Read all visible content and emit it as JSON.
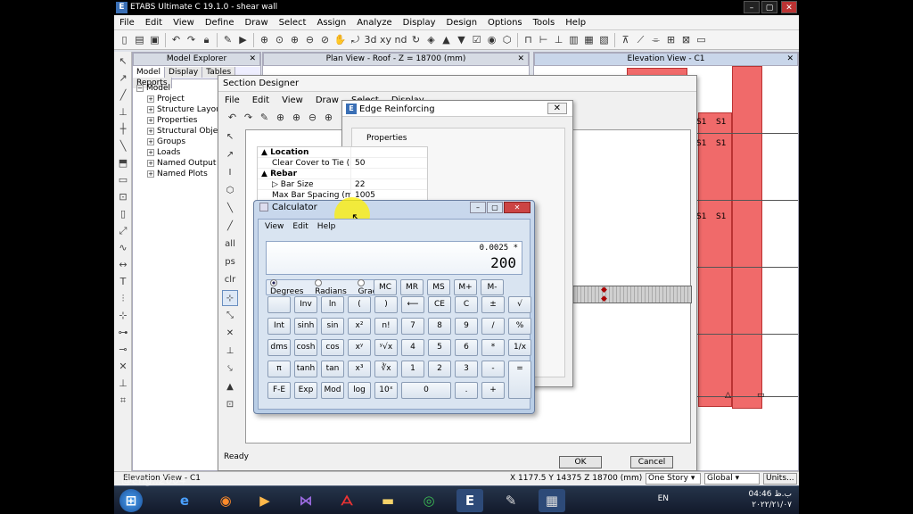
{
  "app": {
    "title": "ETABS Ultimate C 19.1.0 - shear wall"
  },
  "menubar": [
    "File",
    "Edit",
    "View",
    "Define",
    "Draw",
    "Select",
    "Assign",
    "Analyze",
    "Display",
    "Design",
    "Options",
    "Tools",
    "Help"
  ],
  "explorer": {
    "title": "Model Explorer",
    "tabs": [
      "Model",
      "Display",
      "Tables",
      "Reports"
    ],
    "root": "Model",
    "items": [
      "Project",
      "Structure Layout",
      "Properties",
      "Structural Objects",
      "Groups",
      "Loads",
      "Named Output Items",
      "Named Plots"
    ]
  },
  "plan_view": {
    "title": "Plan View - Roof - Z = 18700 (mm)"
  },
  "elevation_view": {
    "title": "Elevation View - C1",
    "labels": [
      "S1",
      "S1",
      "S1",
      "S1",
      "S1",
      "S1"
    ]
  },
  "section_designer": {
    "title": "Section Designer",
    "menu": [
      "File",
      "Edit",
      "View",
      "Draw",
      "Select",
      "Display"
    ],
    "status": "Ready",
    "ok": "OK",
    "cancel": "Cancel"
  },
  "edge_reinforcing": {
    "title": "Edge Reinforcing",
    "group": "Properties",
    "rows": [
      {
        "cat": "Location"
      },
      {
        "k": "Clear Cover to Tie (mm)",
        "v": "50"
      },
      {
        "cat": "Rebar"
      },
      {
        "k": "Bar Size",
        "v": "22"
      },
      {
        "k": "Max Bar Spacing (mm)",
        "v": "1005"
      }
    ]
  },
  "calculator": {
    "title": "Calculator",
    "menu": [
      "View",
      "Edit",
      "Help"
    ],
    "expression": "0.0025 *",
    "display": "200",
    "modes": [
      "Degrees",
      "Radians",
      "Grads"
    ],
    "selected_mode": "Degrees",
    "keys": [
      [
        "MC",
        "MR",
        "MS",
        "M+",
        "M-"
      ],
      [
        "",
        "Inv",
        "ln",
        "(",
        ")",
        "⟵",
        "CE",
        "C",
        "±",
        "√"
      ],
      [
        "Int",
        "sinh",
        "sin",
        "x²",
        "n!",
        "7",
        "8",
        "9",
        "/",
        "%"
      ],
      [
        "dms",
        "cosh",
        "cos",
        "xʸ",
        "ʸ√x",
        "4",
        "5",
        "6",
        "*",
        "1/x"
      ],
      [
        "π",
        "tanh",
        "tan",
        "x³",
        "∛x",
        "1",
        "2",
        "3",
        "-",
        "="
      ],
      [
        "F-E",
        "Exp",
        "Mod",
        "log",
        "10ˣ",
        "0",
        ".",
        "+"
      ]
    ]
  },
  "statusbar": {
    "view": "Elevation View - C1",
    "coords": "X 1177.5  Y 14375  Z 18700 (mm)",
    "story": "One Story",
    "system": "Global",
    "units": "Units..."
  },
  "taskbar": {
    "lang": "EN",
    "time": "04:46",
    "ampm": "ب.ظ",
    "date": "۲۰۲۲/۲۱/۰۷"
  },
  "watermark": "@eng..2004",
  "colors": {
    "wall_fill": "#f06a6a",
    "taskbar": "#1b2538"
  }
}
